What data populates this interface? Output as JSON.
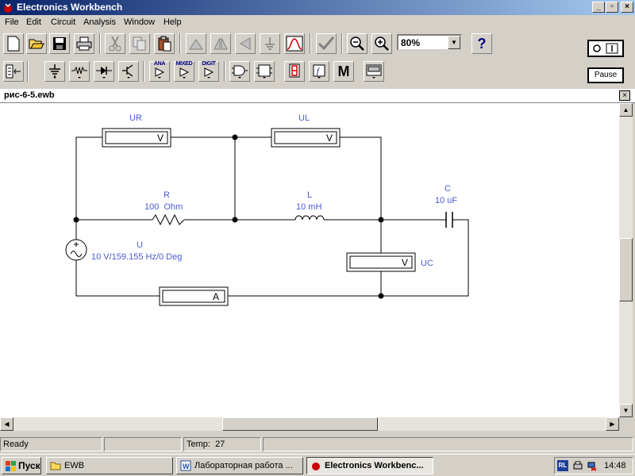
{
  "window": {
    "title": "Electronics Workbench",
    "controls": [
      "_",
      "▫",
      "×"
    ]
  },
  "menu": [
    "File",
    "Edit",
    "Circuit",
    "Analysis",
    "Window",
    "Help"
  ],
  "toolbar": {
    "zoom_value": "80%",
    "help_label": "?",
    "pause_label": "Pause",
    "parts_labels": {
      "analog": "ANA",
      "mixed": "MIXED",
      "digital": "DIGIT"
    },
    "misc_label": "M"
  },
  "document": {
    "filename": "рис-6-5.ewb",
    "close_label": "×"
  },
  "circuit": {
    "meters": [
      {
        "id": "UR",
        "label": "UR",
        "unit": "V"
      },
      {
        "id": "UL",
        "label": "UL",
        "unit": "V"
      },
      {
        "id": "UC",
        "label": "UC",
        "unit": "V"
      },
      {
        "id": "A",
        "label": "",
        "unit": "A"
      }
    ],
    "resistor": {
      "name": "R",
      "value": "100  Ohm"
    },
    "inductor": {
      "name": "L",
      "value": "10 mH"
    },
    "capacitor": {
      "name": "C",
      "value": "10 uF"
    },
    "source": {
      "name": "U",
      "value": "10 V/159.155 Hz/0 Deg"
    },
    "wire_color": "#000000",
    "label_color": "#4a5bd3"
  },
  "status": {
    "message": "Ready",
    "middle": "",
    "temp": "Temp:  27",
    "extra": ""
  },
  "taskbar": {
    "start": "Пуск",
    "tasks": [
      {
        "label": "EWB",
        "active": false
      },
      {
        "label": "Лабораторная работа ...",
        "active": false
      },
      {
        "label": "Electronics Workbenc...",
        "active": true
      }
    ],
    "tray_lang": "RL",
    "clock": "14:48"
  }
}
